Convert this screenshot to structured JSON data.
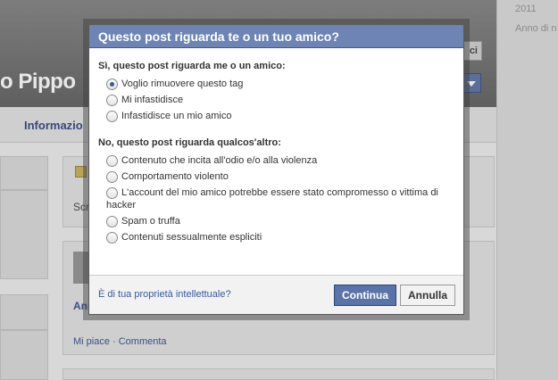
{
  "background": {
    "profile_name": "o Pippo",
    "right_column": [
      "2011",
      "Anno di n"
    ],
    "header_button": "ci",
    "nav_label": "Informazio",
    "card_text_1": "Scr",
    "card_text_2": "Anr",
    "card_actions": "Mi piace · Commenta"
  },
  "dialog": {
    "title": "Questo post riguarda te o un tuo amico?",
    "section_about_me": {
      "title": "Sì, questo post riguarda me o un amico:",
      "options": [
        {
          "label": "Voglio rimuovere questo tag",
          "selected": true
        },
        {
          "label": "Mi infastidisce",
          "selected": false
        },
        {
          "label": "Infastidisce un mio amico",
          "selected": false
        }
      ]
    },
    "section_other": {
      "title": "No, questo post riguarda qualcos'altro:",
      "options": [
        {
          "label": "Contenuto che incita all'odio e/o alla violenza",
          "selected": false
        },
        {
          "label": "Comportamento violento",
          "selected": false
        },
        {
          "label": "L'account del mio amico potrebbe essere stato compromesso o vittima di hacker",
          "selected": false
        },
        {
          "label": "Spam o truffa",
          "selected": false
        },
        {
          "label": "Contenuti sessualmente espliciti",
          "selected": false
        }
      ]
    },
    "footer": {
      "ip_link": "È di tua proprietà intellettuale?",
      "continue_label": "Continua",
      "cancel_label": "Annulla"
    }
  },
  "colors": {
    "title_bar": "#6d84b4",
    "primary_button": "#5b74a8",
    "link": "#3b5998"
  }
}
